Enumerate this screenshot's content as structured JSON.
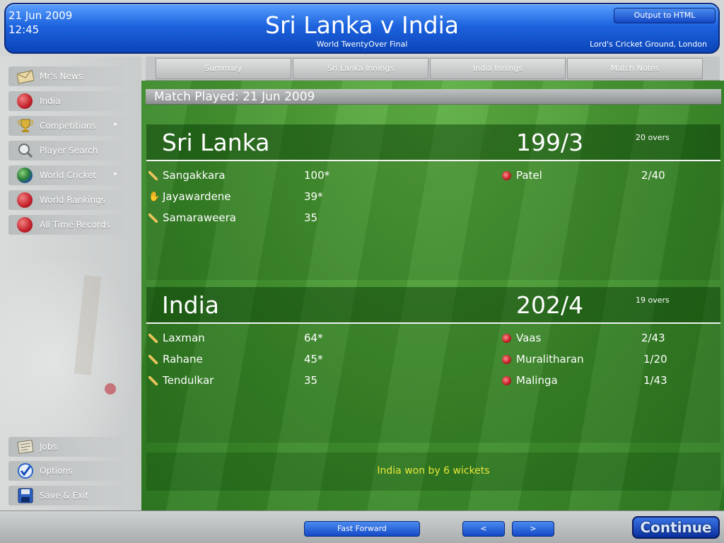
{
  "header": {
    "date": "21 Jun 2009",
    "time": "12:45",
    "title": "Sri Lanka v India",
    "subtitle": "World TwentyOver Final",
    "venue": "Lord's Cricket Ground, London",
    "output_button": "Output to HTML"
  },
  "sidebar": {
    "items": [
      {
        "label": "Mr's News",
        "icon": "envelope-icon"
      },
      {
        "label": "India",
        "icon": "cricket-ball-icon"
      },
      {
        "label": "Competitions",
        "icon": "trophy-icon"
      },
      {
        "label": "Player Search",
        "icon": "magnifier-icon"
      },
      {
        "label": "World Cricket",
        "icon": "globe-icon"
      },
      {
        "label": "World Rankings",
        "icon": "cricket-ball-icon"
      },
      {
        "label": "All Time Records",
        "icon": "cricket-ball-icon"
      }
    ],
    "bottom_items": [
      {
        "label": "Jobs",
        "icon": "newspaper-icon"
      },
      {
        "label": "Options",
        "icon": "checkmark-icon"
      },
      {
        "label": "Save & Exit",
        "icon": "floppy-disk-icon"
      }
    ]
  },
  "tabs": [
    "Summary",
    "Sri Lanka Innings",
    "India Innings",
    "Match Notes"
  ],
  "match_played": "Match Played: 21 Jun 2009",
  "innings": [
    {
      "team": "Sri Lanka",
      "score": "199/3",
      "overs": "20 overs",
      "batting": [
        {
          "name": "Sangakkara",
          "runs": "100*"
        },
        {
          "name": "Jayawardene",
          "runs": "39*"
        },
        {
          "name": "Samaraweera",
          "runs": "35"
        }
      ],
      "bowling": [
        {
          "name": "Patel",
          "figures": "2/40"
        }
      ]
    },
    {
      "team": "India",
      "score": "202/4",
      "overs": "19 overs",
      "batting": [
        {
          "name": "Laxman",
          "runs": "64*"
        },
        {
          "name": "Rahane",
          "runs": "45*"
        },
        {
          "name": "Tendulkar",
          "runs": "35"
        }
      ],
      "bowling": [
        {
          "name": "Vaas",
          "figures": "2/43"
        },
        {
          "name": "Muralitharan",
          "figures": "1/20"
        },
        {
          "name": "Malinga",
          "figures": "1/43"
        }
      ]
    }
  ],
  "result": "India won by 6 wickets",
  "footer": {
    "fast_forward": "Fast Forward",
    "prev": "<",
    "next": ">",
    "continue": "Continue"
  }
}
